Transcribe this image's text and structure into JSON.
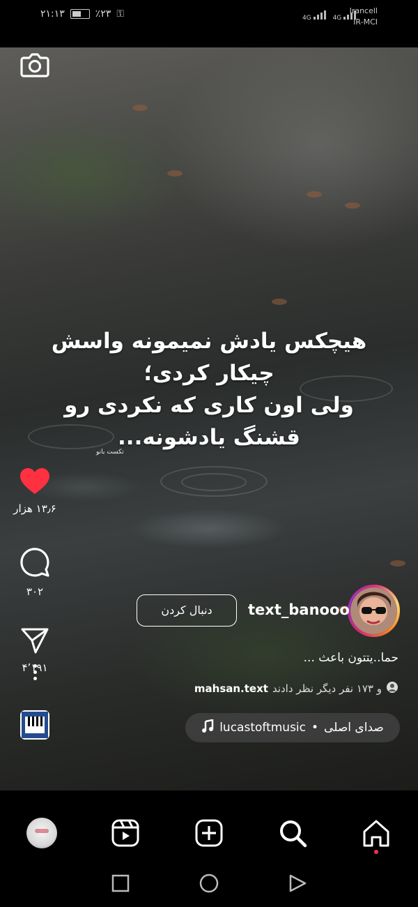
{
  "status_bar": {
    "time": "۲۱:۱۳",
    "battery": "٪۲۳",
    "network_type_1": "4G",
    "network_type_2": "4G",
    "carrier_1": "Irancell",
    "carrier_2": "IR-MCI"
  },
  "reel": {
    "quote_lines": [
      "هیچکس یادش نمیمونه واسش",
      "چیکار کردی؛",
      "ولی اون کاری که نکردی رو",
      "قشنگ یادشونه..."
    ],
    "signature": "تکست بانو"
  },
  "actions": {
    "likes": "۱۳٫۶ هزار",
    "comments": "۳۰۲",
    "shares": "۴٬۱۹۱"
  },
  "profile": {
    "username": "text_banooo",
    "follow_label": "دنبال کردن",
    "caption": "حما..یتتون باعث ...",
    "liked_by_user": "mahsan.text",
    "liked_by_rest": "و ۱۷۳ نفر دیگر نظر دادند",
    "audio_original": "صدای اصلی",
    "audio_separator": "•",
    "audio_artist": "lucastoftmusic"
  },
  "colors": {
    "like_red": "#ff3040",
    "home_dot": "#ff2d55"
  },
  "icons": {
    "camera": "camera-icon",
    "heart": "heart-icon",
    "comment": "comment-icon",
    "share": "send-icon",
    "more": "more-vertical-icon",
    "music": "music-note-icon",
    "piano": "piano-icon",
    "reels": "reels-icon",
    "create": "plus-square-icon",
    "search": "search-icon",
    "home": "home-icon"
  }
}
